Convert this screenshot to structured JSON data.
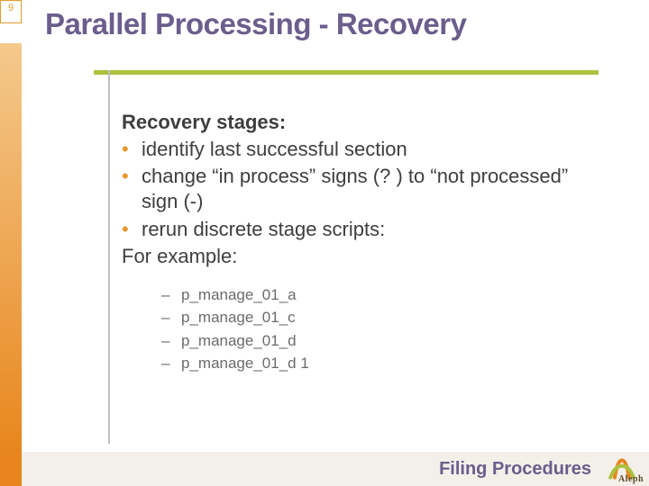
{
  "page_number": "9",
  "title": "Parallel Processing - Recovery",
  "content": {
    "heading": "Recovery stages:",
    "bullets": [
      "identify last successful section",
      "change “in process” signs (? ) to “not processed” sign (-)",
      "rerun discrete stage scripts:"
    ],
    "for_example": "For example:",
    "sub_items": [
      "p_manage_01_a",
      "p_manage_01_c",
      "p_manage_01_d",
      "p_manage_01_d 1"
    ]
  },
  "footer": {
    "label": "Filing Procedures",
    "logo_text": "Aleph"
  },
  "colors": {
    "title": "#6B5D8C",
    "accent_orange": "#E8851C",
    "accent_green": "#A9C23F"
  }
}
